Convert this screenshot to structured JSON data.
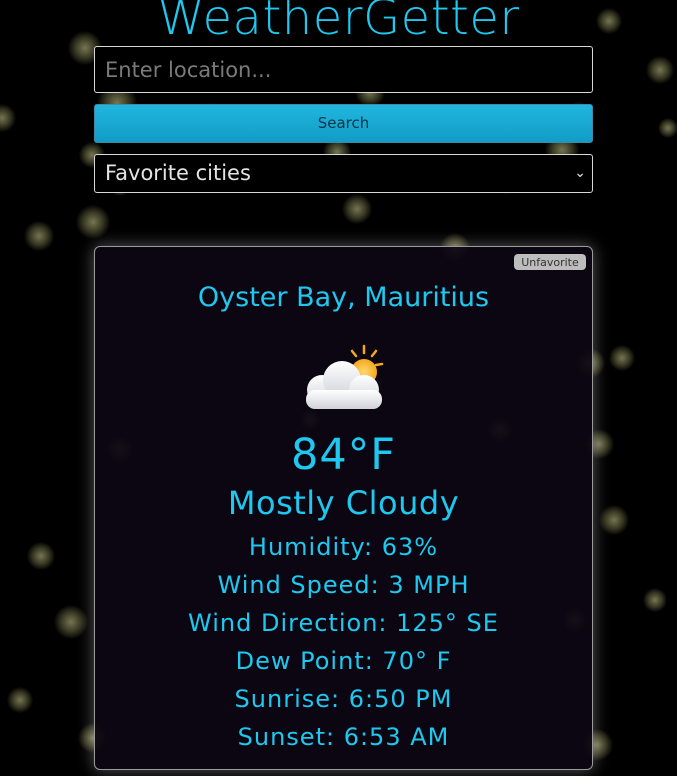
{
  "app": {
    "title": "WeatherGetter",
    "accent_color": "#1ec8ef"
  },
  "search": {
    "placeholder": "Enter location...",
    "value": "",
    "button_label": "Search"
  },
  "favorites": {
    "selected_label": "Favorite cities"
  },
  "card": {
    "unfavorite_label": "Unfavorite",
    "location": "Oyster Bay, Mauritius",
    "icon": "partly-cloudy-icon",
    "temperature": "84°F",
    "condition": "Mostly Cloudy",
    "humidity": "Humidity: 63%",
    "wind_speed": "Wind Speed: 3 MPH",
    "wind_direction": "Wind Direction: 125° SE",
    "dew_point": "Dew Point: 70° F",
    "sunrise": "Sunrise: 6:50 PM",
    "sunset": "Sunset: 6:53 AM"
  }
}
